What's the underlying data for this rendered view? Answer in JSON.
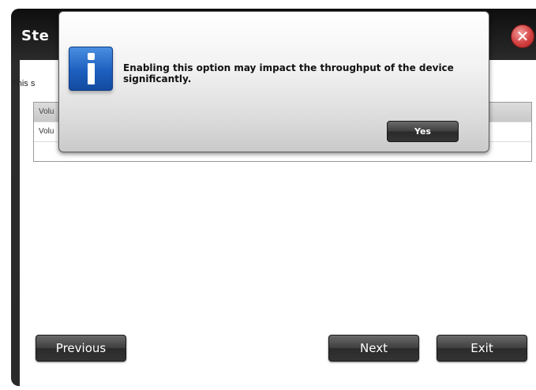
{
  "window": {
    "title": "Ste",
    "close_icon": "close-icon",
    "close_glyph": "✕"
  },
  "content": {
    "description": "This s",
    "table_rows": [
      {
        "label": "Volu"
      },
      {
        "label": "Volu"
      }
    ]
  },
  "footer": {
    "previous_label": "Previous",
    "next_label": "Next",
    "exit_label": "Exit"
  },
  "modal": {
    "icon": "info-icon",
    "message": "Enabling this option may impact the throughput of the device significantly.",
    "yes_label": "Yes"
  },
  "colors": {
    "close_red": "#d44040",
    "info_blue": "#1d5fbf",
    "window_dark": "#2a2a2a"
  }
}
